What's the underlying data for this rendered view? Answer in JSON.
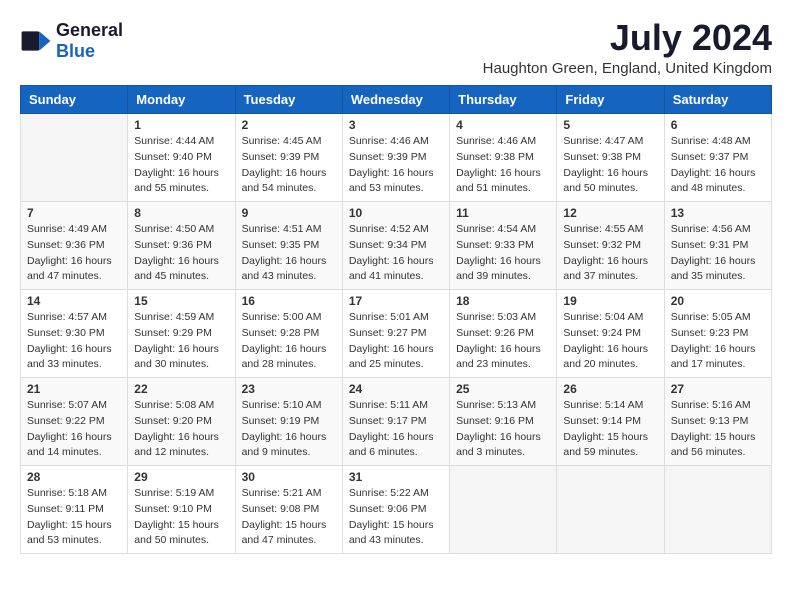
{
  "header": {
    "logo_general": "General",
    "logo_blue": "Blue",
    "month_year": "July 2024",
    "location": "Haughton Green, England, United Kingdom"
  },
  "days_of_week": [
    "Sunday",
    "Monday",
    "Tuesday",
    "Wednesday",
    "Thursday",
    "Friday",
    "Saturday"
  ],
  "weeks": [
    [
      {
        "day": "",
        "info": ""
      },
      {
        "day": "1",
        "info": "Sunrise: 4:44 AM\nSunset: 9:40 PM\nDaylight: 16 hours\nand 55 minutes."
      },
      {
        "day": "2",
        "info": "Sunrise: 4:45 AM\nSunset: 9:39 PM\nDaylight: 16 hours\nand 54 minutes."
      },
      {
        "day": "3",
        "info": "Sunrise: 4:46 AM\nSunset: 9:39 PM\nDaylight: 16 hours\nand 53 minutes."
      },
      {
        "day": "4",
        "info": "Sunrise: 4:46 AM\nSunset: 9:38 PM\nDaylight: 16 hours\nand 51 minutes."
      },
      {
        "day": "5",
        "info": "Sunrise: 4:47 AM\nSunset: 9:38 PM\nDaylight: 16 hours\nand 50 minutes."
      },
      {
        "day": "6",
        "info": "Sunrise: 4:48 AM\nSunset: 9:37 PM\nDaylight: 16 hours\nand 48 minutes."
      }
    ],
    [
      {
        "day": "7",
        "info": "Sunrise: 4:49 AM\nSunset: 9:36 PM\nDaylight: 16 hours\nand 47 minutes."
      },
      {
        "day": "8",
        "info": "Sunrise: 4:50 AM\nSunset: 9:36 PM\nDaylight: 16 hours\nand 45 minutes."
      },
      {
        "day": "9",
        "info": "Sunrise: 4:51 AM\nSunset: 9:35 PM\nDaylight: 16 hours\nand 43 minutes."
      },
      {
        "day": "10",
        "info": "Sunrise: 4:52 AM\nSunset: 9:34 PM\nDaylight: 16 hours\nand 41 minutes."
      },
      {
        "day": "11",
        "info": "Sunrise: 4:54 AM\nSunset: 9:33 PM\nDaylight: 16 hours\nand 39 minutes."
      },
      {
        "day": "12",
        "info": "Sunrise: 4:55 AM\nSunset: 9:32 PM\nDaylight: 16 hours\nand 37 minutes."
      },
      {
        "day": "13",
        "info": "Sunrise: 4:56 AM\nSunset: 9:31 PM\nDaylight: 16 hours\nand 35 minutes."
      }
    ],
    [
      {
        "day": "14",
        "info": "Sunrise: 4:57 AM\nSunset: 9:30 PM\nDaylight: 16 hours\nand 33 minutes."
      },
      {
        "day": "15",
        "info": "Sunrise: 4:59 AM\nSunset: 9:29 PM\nDaylight: 16 hours\nand 30 minutes."
      },
      {
        "day": "16",
        "info": "Sunrise: 5:00 AM\nSunset: 9:28 PM\nDaylight: 16 hours\nand 28 minutes."
      },
      {
        "day": "17",
        "info": "Sunrise: 5:01 AM\nSunset: 9:27 PM\nDaylight: 16 hours\nand 25 minutes."
      },
      {
        "day": "18",
        "info": "Sunrise: 5:03 AM\nSunset: 9:26 PM\nDaylight: 16 hours\nand 23 minutes."
      },
      {
        "day": "19",
        "info": "Sunrise: 5:04 AM\nSunset: 9:24 PM\nDaylight: 16 hours\nand 20 minutes."
      },
      {
        "day": "20",
        "info": "Sunrise: 5:05 AM\nSunset: 9:23 PM\nDaylight: 16 hours\nand 17 minutes."
      }
    ],
    [
      {
        "day": "21",
        "info": "Sunrise: 5:07 AM\nSunset: 9:22 PM\nDaylight: 16 hours\nand 14 minutes."
      },
      {
        "day": "22",
        "info": "Sunrise: 5:08 AM\nSunset: 9:20 PM\nDaylight: 16 hours\nand 12 minutes."
      },
      {
        "day": "23",
        "info": "Sunrise: 5:10 AM\nSunset: 9:19 PM\nDaylight: 16 hours\nand 9 minutes."
      },
      {
        "day": "24",
        "info": "Sunrise: 5:11 AM\nSunset: 9:17 PM\nDaylight: 16 hours\nand 6 minutes."
      },
      {
        "day": "25",
        "info": "Sunrise: 5:13 AM\nSunset: 9:16 PM\nDaylight: 16 hours\nand 3 minutes."
      },
      {
        "day": "26",
        "info": "Sunrise: 5:14 AM\nSunset: 9:14 PM\nDaylight: 15 hours\nand 59 minutes."
      },
      {
        "day": "27",
        "info": "Sunrise: 5:16 AM\nSunset: 9:13 PM\nDaylight: 15 hours\nand 56 minutes."
      }
    ],
    [
      {
        "day": "28",
        "info": "Sunrise: 5:18 AM\nSunset: 9:11 PM\nDaylight: 15 hours\nand 53 minutes."
      },
      {
        "day": "29",
        "info": "Sunrise: 5:19 AM\nSunset: 9:10 PM\nDaylight: 15 hours\nand 50 minutes."
      },
      {
        "day": "30",
        "info": "Sunrise: 5:21 AM\nSunset: 9:08 PM\nDaylight: 15 hours\nand 47 minutes."
      },
      {
        "day": "31",
        "info": "Sunrise: 5:22 AM\nSunset: 9:06 PM\nDaylight: 15 hours\nand 43 minutes."
      },
      {
        "day": "",
        "info": ""
      },
      {
        "day": "",
        "info": ""
      },
      {
        "day": "",
        "info": ""
      }
    ]
  ]
}
